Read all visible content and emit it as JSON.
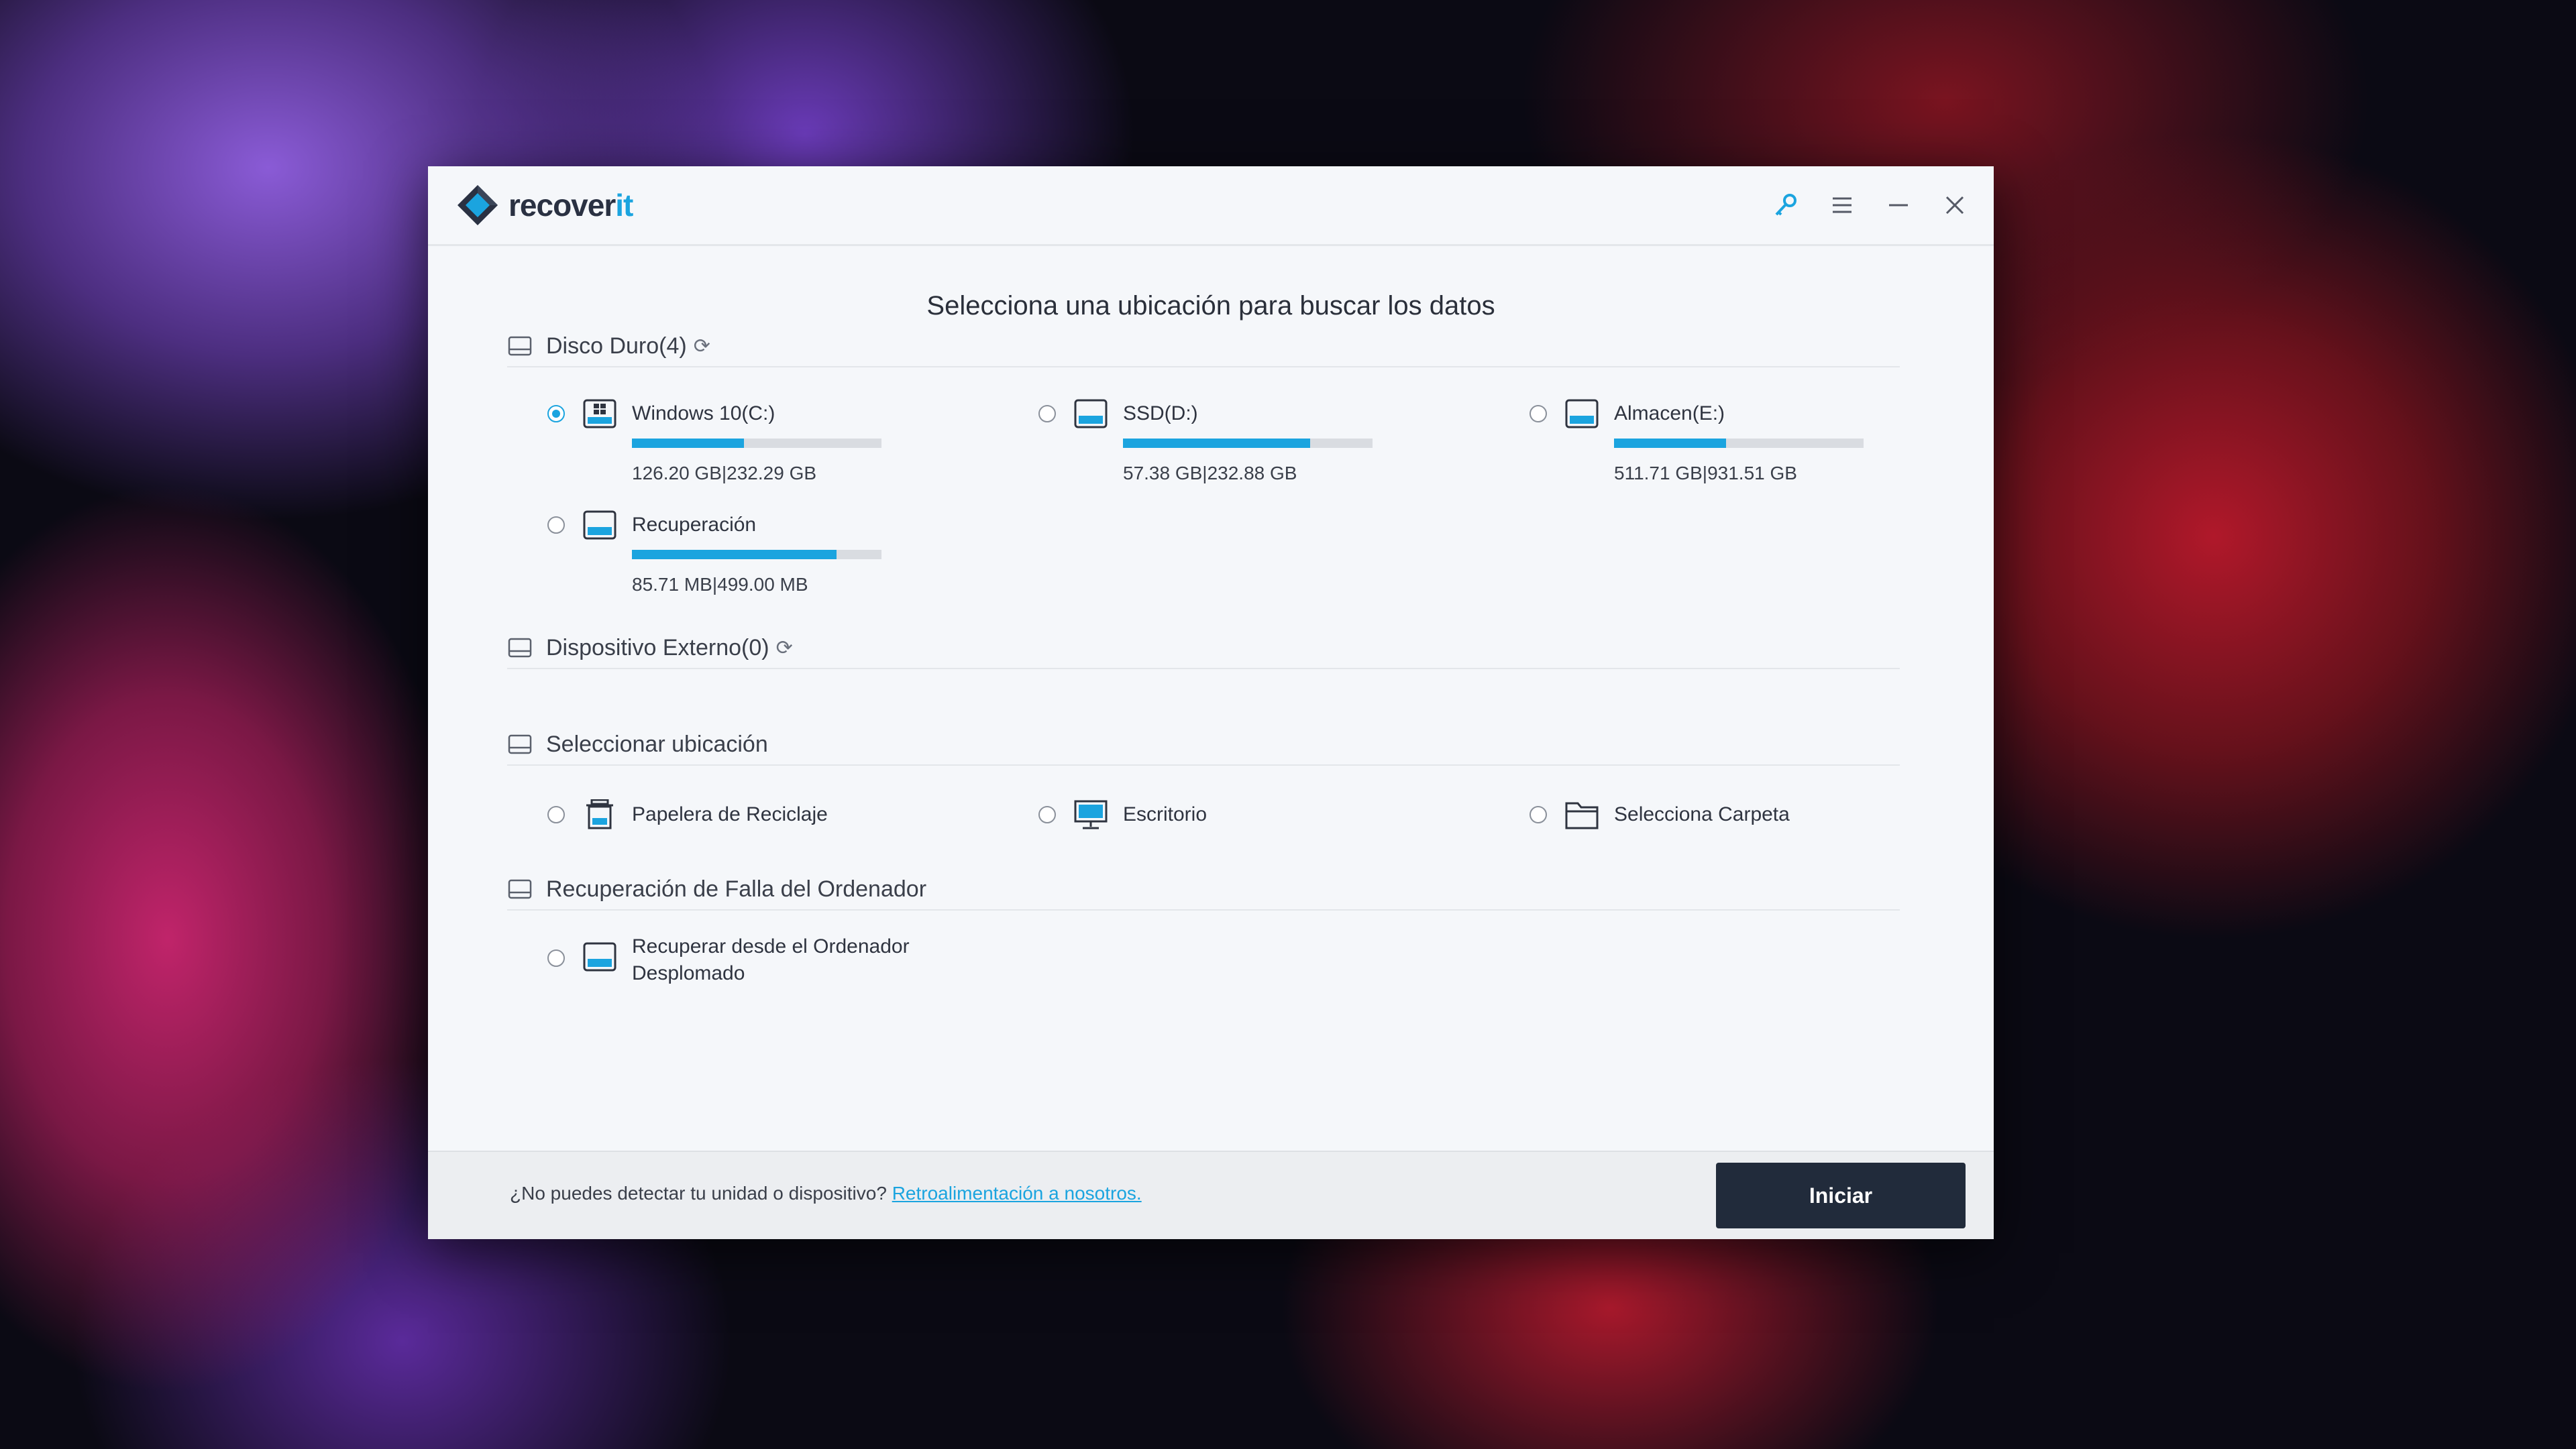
{
  "app": {
    "name_main": "recover",
    "name_accent": "it"
  },
  "titlebar": {
    "key_icon": "key-icon",
    "menu_icon": "menu-icon",
    "minimize_icon": "minimize-icon",
    "close_icon": "close-icon"
  },
  "heading": "Selecciona una ubicación para buscar los datos",
  "sections": {
    "hard_disk": {
      "label": "Disco Duro(4)"
    },
    "external": {
      "label": "Dispositivo Externo(0)"
    },
    "select_location": {
      "label": "Seleccionar ubicación"
    },
    "crash_recovery": {
      "label": "Recuperación de Falla del Ordenador"
    }
  },
  "drives": [
    {
      "label": "Windows 10(C:)",
      "size": "126.20  GB|232.29  GB",
      "fill": 0.45,
      "selected": true
    },
    {
      "label": "SSD(D:)",
      "size": "57.38  GB|232.88  GB",
      "fill": 0.75,
      "selected": false
    },
    {
      "label": "Almacen(E:)",
      "size": "511.71  GB|931.51  GB",
      "fill": 0.45,
      "selected": false
    },
    {
      "label": "Recuperación",
      "size": "85.71  MB|499.00  MB",
      "fill": 0.82,
      "selected": false
    }
  ],
  "locations": [
    {
      "label": "Papelera de Reciclaje",
      "icon": "trash-icon"
    },
    {
      "label": "Escritorio",
      "icon": "desktop-icon"
    },
    {
      "label": "Selecciona Carpeta",
      "icon": "folder-icon"
    }
  ],
  "crash": {
    "line1": "Recuperar desde el Ordenador",
    "line2": "Desplomado"
  },
  "footer": {
    "question": "¿No puedes detectar tu unidad o dispositivo? ",
    "link": "Retroalimentación a nosotros.",
    "start": "Iniciar"
  },
  "colors": {
    "accent": "#1ba4df",
    "button": "#212b3b"
  }
}
